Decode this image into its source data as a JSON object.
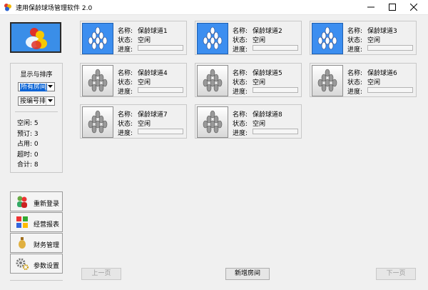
{
  "window": {
    "title": "速用保龄球场管理软件 2.0"
  },
  "sidebar": {
    "panel_title": "显示与排序",
    "filter_select": "所有房间",
    "sort_select": "按编号排",
    "stats": [
      {
        "label": "空闲",
        "value": "5"
      },
      {
        "label": "预订",
        "value": "3"
      },
      {
        "label": "占用",
        "value": "0"
      },
      {
        "label": "超时",
        "value": "0"
      },
      {
        "label": "合计",
        "value": "8"
      }
    ],
    "menu": [
      {
        "label": "重新登录",
        "icon": "users-icon"
      },
      {
        "label": "经营报表",
        "icon": "report-icon"
      },
      {
        "label": "财务管理",
        "icon": "finance-icon"
      },
      {
        "label": "参数设置",
        "icon": "gear-icon"
      }
    ]
  },
  "lane_labels": {
    "name": "名称:",
    "status": "状态:",
    "progress": "进度:"
  },
  "lanes": [
    {
      "name": "保龄球道1",
      "status": "空闲",
      "active": true,
      "progress": 0
    },
    {
      "name": "保龄球道2",
      "status": "空闲",
      "active": true,
      "progress": 0
    },
    {
      "name": "保龄球道3",
      "status": "空闲",
      "active": true,
      "progress": 0
    },
    {
      "name": "保龄球道4",
      "status": "空闲",
      "active": false,
      "progress": 0
    },
    {
      "name": "保龄球道5",
      "status": "空闲",
      "active": false,
      "progress": 0
    },
    {
      "name": "保龄球道6",
      "status": "空闲",
      "active": false,
      "progress": 0
    },
    {
      "name": "保龄球道7",
      "status": "空闲",
      "active": false,
      "progress": 0
    },
    {
      "name": "保龄球道8",
      "status": "空闲",
      "active": false,
      "progress": 0
    }
  ],
  "footer": {
    "prev_label": "上一页",
    "new_label": "新增房间",
    "next_label": "下一页"
  },
  "colors": {
    "active_lane": "#3c8ef0",
    "selection": "#0a64d6"
  }
}
